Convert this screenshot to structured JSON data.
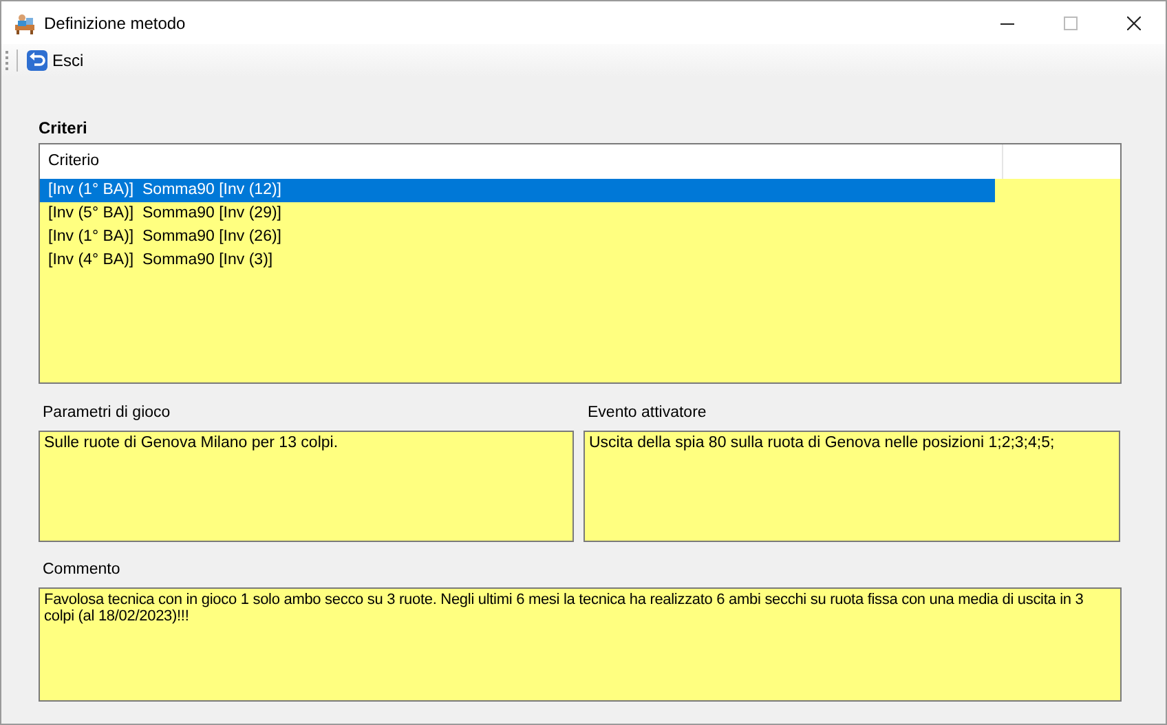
{
  "window": {
    "title": "Definizione metodo"
  },
  "toolbar": {
    "buttons": [
      {
        "label": "Esci"
      }
    ]
  },
  "criteri": {
    "title": "Criteri",
    "columns": [
      "Criterio"
    ],
    "rows": [
      {
        "text": "[Inv (1° BA)]  Somma90 [Inv (12)]",
        "selected": true
      },
      {
        "text": "[Inv (5° BA)]  Somma90 [Inv (29)]",
        "selected": false
      },
      {
        "text": "[Inv (1° BA)]  Somma90 [Inv (26)]",
        "selected": false
      },
      {
        "text": "[Inv (4° BA)]  Somma90 [Inv (3)]",
        "selected": false
      }
    ]
  },
  "parametri": {
    "label": "Parametri di gioco",
    "value": "Sulle ruote di Genova Milano per 13 colpi."
  },
  "evento": {
    "label": "Evento attivatore",
    "value": "Uscita della spia 80 sulla ruota di Genova nelle posizioni 1;2;3;4;5;"
  },
  "commento": {
    "label": "Commento",
    "value": "Favolosa tecnica con in gioco 1 solo ambo secco su 3 ruote. Negli ultimi 6 mesi la tecnica ha realizzato 6 ambi secchi su ruota fissa con una media di uscita in 3 colpi (al 18/02/2023)!!!"
  }
}
